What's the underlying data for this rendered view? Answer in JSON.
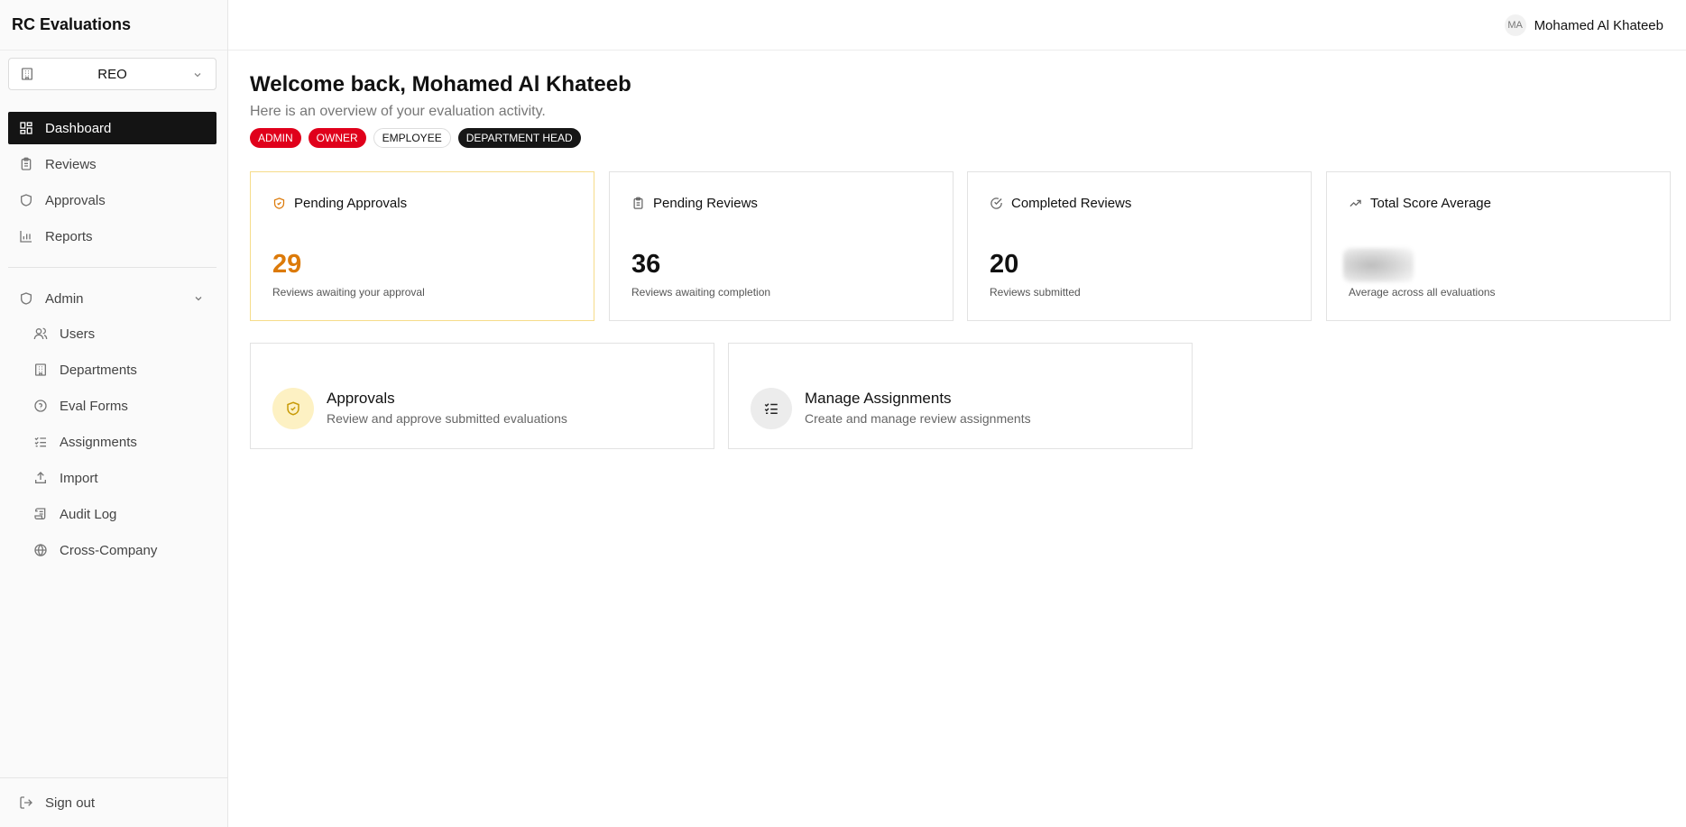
{
  "app": {
    "title": "RC Evaluations"
  },
  "org_selector": {
    "value": "REO"
  },
  "nav": {
    "items": [
      {
        "label": "Dashboard",
        "icon": "dashboard-icon",
        "active": true
      },
      {
        "label": "Reviews",
        "icon": "clipboard-icon"
      },
      {
        "label": "Approvals",
        "icon": "shield-icon"
      },
      {
        "label": "Reports",
        "icon": "bar-chart-icon"
      }
    ],
    "admin": {
      "label": "Admin",
      "items": [
        {
          "label": "Users",
          "icon": "users-icon"
        },
        {
          "label": "Departments",
          "icon": "building-icon"
        },
        {
          "label": "Eval Forms",
          "icon": "help-circle-icon"
        },
        {
          "label": "Assignments",
          "icon": "list-checks-icon"
        },
        {
          "label": "Import",
          "icon": "upload-icon"
        },
        {
          "label": "Audit Log",
          "icon": "scroll-icon"
        },
        {
          "label": "Cross-Company",
          "icon": "globe-icon"
        }
      ]
    },
    "signout": "Sign out"
  },
  "user": {
    "initials": "MA",
    "name": "Mohamed Al Khateeb"
  },
  "welcome": {
    "title": "Welcome back, Mohamed Al Khateeb",
    "subtitle": "Here is an overview of your evaluation activity."
  },
  "roles": [
    "ADMIN",
    "OWNER",
    "EMPLOYEE",
    "DEPARTMENT HEAD"
  ],
  "stats": [
    {
      "title": "Pending Approvals",
      "value": "29",
      "desc": "Reviews awaiting your approval",
      "icon": "shield-check-icon"
    },
    {
      "title": "Pending Reviews",
      "value": "36",
      "desc": "Reviews awaiting completion",
      "icon": "clipboard-icon"
    },
    {
      "title": "Completed Reviews",
      "value": "20",
      "desc": "Reviews submitted",
      "icon": "check-circle-icon"
    },
    {
      "title": "Total Score Average",
      "value": "",
      "desc": "Average across all evaluations",
      "icon": "trending-up-icon"
    }
  ],
  "actions": [
    {
      "title": "Approvals",
      "desc": "Review and approve submitted evaluations",
      "icon": "shield-check-icon"
    },
    {
      "title": "Manage Assignments",
      "desc": "Create and manage review assignments",
      "icon": "list-checks-icon"
    }
  ],
  "colors": {
    "accent_orange": "#dc7a09",
    "role_red": "#e0001b",
    "active_nav": "#141414",
    "highlight_border": "#f6dc8a"
  }
}
